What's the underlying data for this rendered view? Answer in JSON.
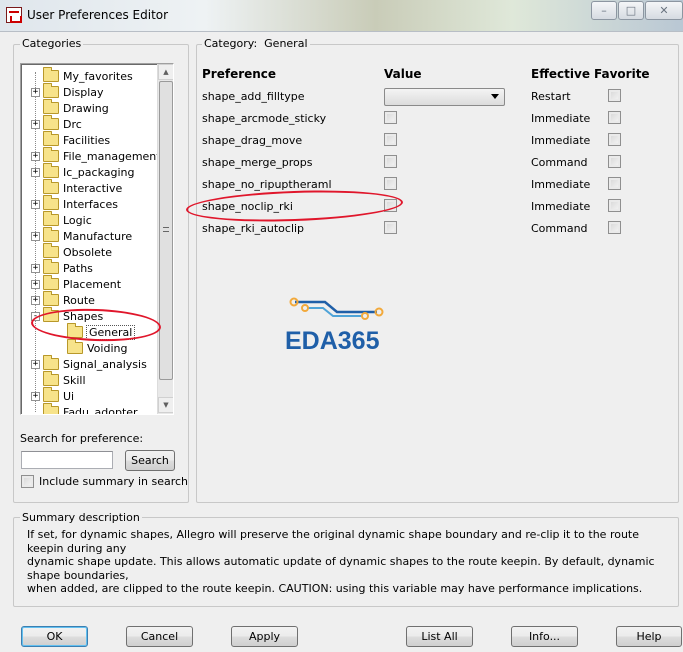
{
  "window": {
    "title": "User Preferences Editor",
    "controls": {
      "minimize": "–",
      "maximize": "□",
      "close": "✕"
    }
  },
  "categories_panel": {
    "label": "Categories",
    "tree": [
      {
        "label": "My_favorites",
        "expander": "",
        "depth": 0
      },
      {
        "label": "Display",
        "expander": "+",
        "depth": 0
      },
      {
        "label": "Drawing",
        "expander": "",
        "depth": 0
      },
      {
        "label": "Drc",
        "expander": "+",
        "depth": 0
      },
      {
        "label": "Facilities",
        "expander": "",
        "depth": 0
      },
      {
        "label": "File_management",
        "expander": "+",
        "depth": 0
      },
      {
        "label": "Ic_packaging",
        "expander": "+",
        "depth": 0
      },
      {
        "label": "Interactive",
        "expander": "",
        "depth": 0
      },
      {
        "label": "Interfaces",
        "expander": "+",
        "depth": 0
      },
      {
        "label": "Logic",
        "expander": "",
        "depth": 0
      },
      {
        "label": "Manufacture",
        "expander": "+",
        "depth": 0
      },
      {
        "label": "Obsolete",
        "expander": "",
        "depth": 0
      },
      {
        "label": "Paths",
        "expander": "+",
        "depth": 0
      },
      {
        "label": "Placement",
        "expander": "+",
        "depth": 0
      },
      {
        "label": "Route",
        "expander": "+",
        "depth": 0
      },
      {
        "label": "Shapes",
        "expander": "-",
        "depth": 0
      },
      {
        "label": "General",
        "expander": "",
        "depth": 1,
        "selected": true
      },
      {
        "label": "Voiding",
        "expander": "",
        "depth": 1
      },
      {
        "label": "Signal_analysis",
        "expander": "+",
        "depth": 0
      },
      {
        "label": "Skill",
        "expander": "",
        "depth": 0
      },
      {
        "label": "Ui",
        "expander": "+",
        "depth": 0
      },
      {
        "label": "Fadu_adopter",
        "expander": "",
        "depth": 0
      }
    ],
    "search_label": "Search for preference:",
    "search_value": "",
    "search_button": "Search",
    "include_summary_label": "Include summary in search",
    "include_summary_checked": false
  },
  "category_panel": {
    "prefix": "Category:",
    "name": "General",
    "headers": {
      "preference": "Preference",
      "value": "Value",
      "effective": "Effective",
      "favorite": "Favorite"
    },
    "rows": [
      {
        "name": "shape_add_filltype",
        "value_type": "dropdown",
        "value": "",
        "effective": "Restart",
        "favorite": false
      },
      {
        "name": "shape_arcmode_sticky",
        "value_type": "checkbox",
        "value": false,
        "effective": "Immediate",
        "favorite": false
      },
      {
        "name": "shape_drag_move",
        "value_type": "checkbox",
        "value": false,
        "effective": "Immediate",
        "favorite": false
      },
      {
        "name": "shape_merge_props",
        "value_type": "checkbox",
        "value": false,
        "effective": "Command",
        "favorite": false
      },
      {
        "name": "shape_no_ripuptheraml",
        "value_type": "checkbox",
        "value": false,
        "effective": "Immediate",
        "favorite": false
      },
      {
        "name": "shape_noclip_rki",
        "value_type": "checkbox",
        "value": false,
        "effective": "Immediate",
        "favorite": false
      },
      {
        "name": "shape_rki_autoclip",
        "value_type": "checkbox",
        "value": false,
        "effective": "Command",
        "favorite": false
      }
    ],
    "watermark": "EDA365",
    "watermark_color": "#1f5fa8",
    "watermark_accent": "#f2a93b"
  },
  "summary": {
    "label": "Summary description",
    "lines": [
      "If set, for dynamic shapes, Allegro will preserve the original dynamic shape boundary and re-clip it to the route keepin during any",
      "dynamic shape update. This allows automatic update of dynamic shapes to the route keepin. By default, dynamic shape boundaries,",
      "when added, are clipped to the route keepin. CAUTION: using this variable may have performance implications."
    ]
  },
  "buttons": {
    "ok": "OK",
    "cancel": "Cancel",
    "apply": "Apply",
    "list_all": "List All",
    "info": "Info...",
    "help": "Help"
  },
  "annotation_color": "#e0162b"
}
